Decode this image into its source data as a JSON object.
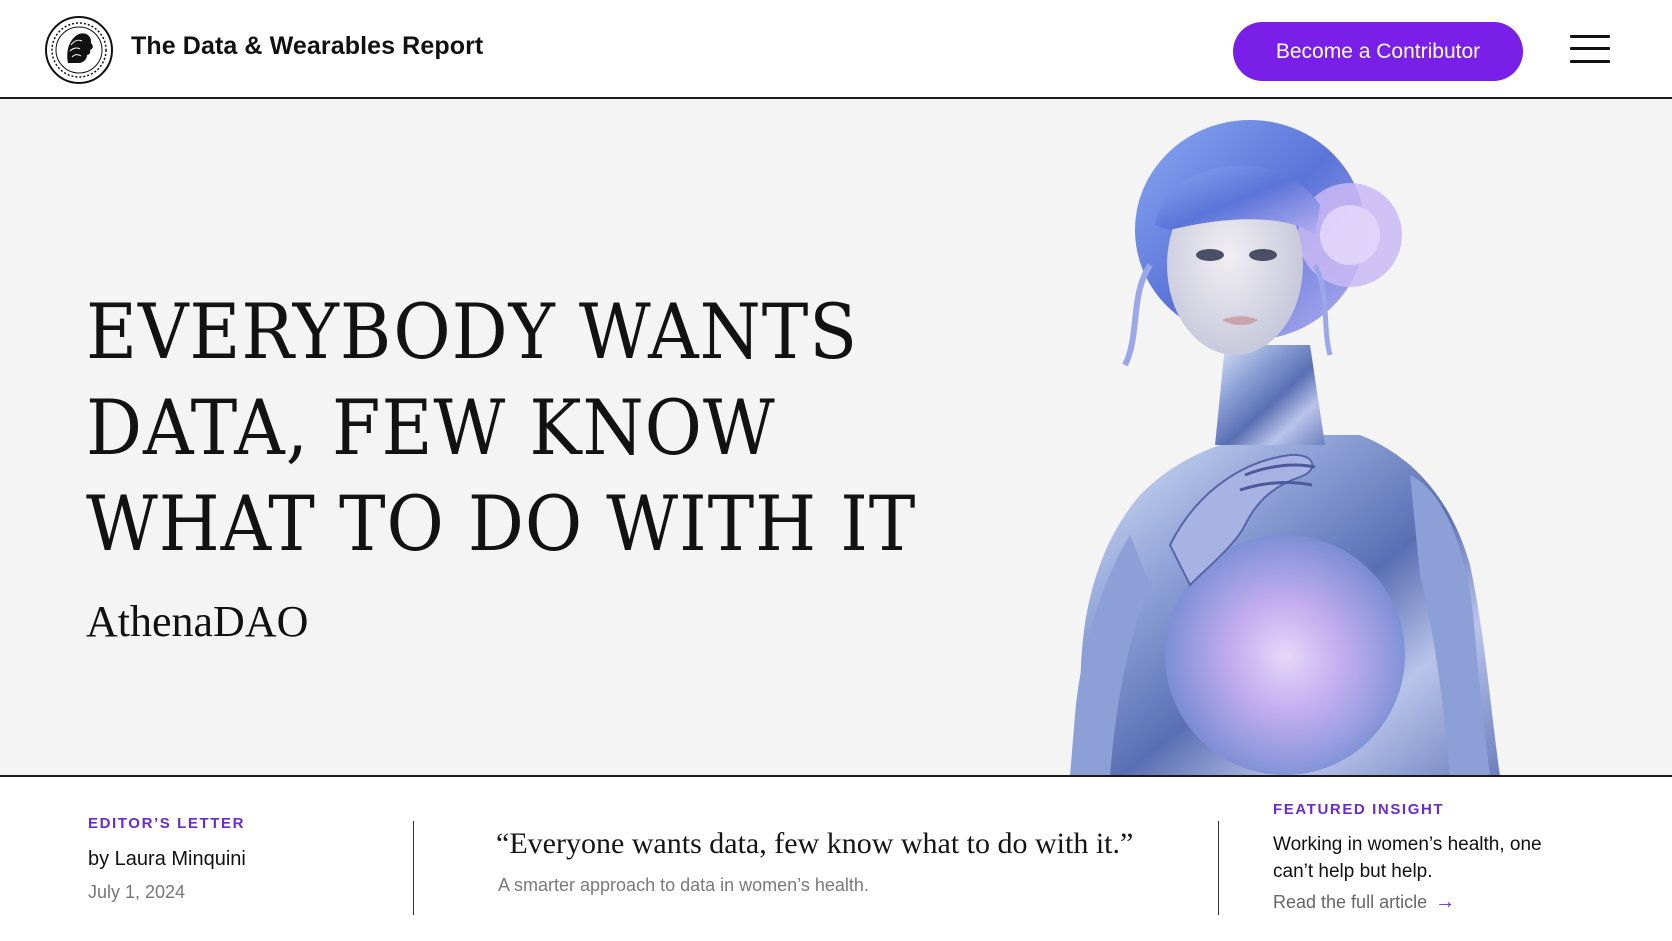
{
  "header": {
    "site_title": "The Data & Wearables Report",
    "cta_label": "Become a Contributor",
    "logo_icon": "medallion-logo-icon",
    "menu_icon": "hamburger-menu-icon"
  },
  "hero": {
    "headline_lines": [
      "EVERYBODY WANTS",
      "DATA, FEW KNOW",
      "WHAT TO DO WITH IT"
    ],
    "byline": "AthenaDAO",
    "image_icon": "chrome-android-figure-image"
  },
  "bottom": {
    "editors": {
      "kicker": "EDITOR’S LETTER",
      "author": "by Laura Minquini",
      "date": "July 1, 2024"
    },
    "quote": {
      "text": "“Everyone wants data, few know what to do with it.”",
      "subtitle": "A smarter approach to data in women’s health."
    },
    "featured": {
      "kicker": "FEATURED INSIGHT",
      "text": "Working in women’s health, one can’t help but help.",
      "link_label": "Read the full article",
      "arrow": "→"
    }
  },
  "colors": {
    "accent": "#7a1fe8",
    "kicker": "#6a2bd0",
    "background": "#f4f4f5"
  }
}
